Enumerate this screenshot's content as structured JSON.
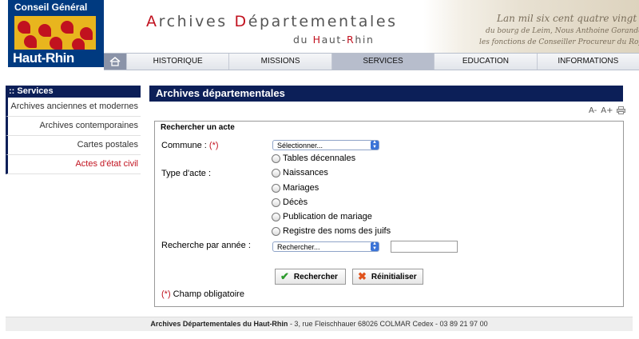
{
  "header": {
    "logo_top": "Conseil Général",
    "logo_bottom": "Haut-Rhin",
    "title_1": "A",
    "title_2": "rchives ",
    "title_3": "D",
    "title_4": "épartementales",
    "subtitle_1": "du ",
    "subtitle_2": "H",
    "subtitle_3": "aut-",
    "subtitle_4": "R",
    "subtitle_5": "hin",
    "script_text": [
      "Lan mil six cent quatre vingt trois",
      "du bourg de Leim, Nous Anthoine Gorandel",
      "les fonctions de Conseiller Procureur du Roy"
    ]
  },
  "nav": {
    "items": [
      "HISTORIQUE",
      "MISSIONS",
      "SERVICES",
      "EDUCATION",
      "INFORMATIONS"
    ],
    "active": "SERVICES"
  },
  "sidebar": {
    "title": ":: Services",
    "items": [
      {
        "label": "Archives anciennes et modernes"
      },
      {
        "label": "Archives contemporaines"
      },
      {
        "label": "Cartes postales"
      },
      {
        "label": "Actes d'état civil"
      }
    ]
  },
  "main": {
    "title": "Archives départementales",
    "tools": {
      "decrease": "A-",
      "increase": "A+",
      "print_icon": "printer-icon"
    },
    "legend": "Rechercher un acte",
    "commune_label": "Commune : ",
    "required_mark": "(*)",
    "commune_select": "Sélectionner...",
    "type_label": "Type d'acte :",
    "types": [
      "Tables décennales",
      "Naissances",
      "Mariages",
      "Décès",
      "Publication de mariage",
      "Registre des noms des juifs"
    ],
    "year_label": "Recherche par année :",
    "year_select": "Rechercher...",
    "year_value": "",
    "search_button": "Rechercher",
    "reset_button": "Réinitialiser",
    "required_note": " Champ obligatoire"
  },
  "footer": {
    "org": "Archives Départementales du Haut-Rhin",
    "address": " - 3, rue Fleischhauer 68026 COLMAR Cedex - 03 89 21 97 00"
  },
  "colors": {
    "navy": "#0c1f58",
    "red": "#c1121f",
    "logo_blue": "#003a80",
    "logo_yellow": "#e8b51e"
  }
}
